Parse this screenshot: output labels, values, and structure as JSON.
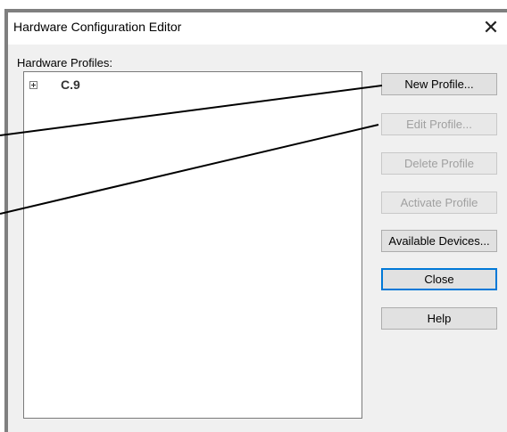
{
  "window": {
    "title": "Hardware Configuration Editor",
    "close_glyph": "✕",
    "close_icon": "close-icon"
  },
  "profiles": {
    "group_label": "Hardware Profiles:",
    "items": [
      {
        "label": "C.9",
        "expander_icon": "plus-expander-icon"
      }
    ]
  },
  "buttons": {
    "new_profile": "New Profile...",
    "edit_profile": "Edit Profile...",
    "delete_profile": "Delete Profile",
    "activate_profile": "Activate Profile",
    "available_devices": "Available Devices...",
    "close": "Close",
    "help": "Help"
  },
  "colors": {
    "dialog_bg": "#f0f0f0",
    "focus_border": "#0078d7",
    "disabled_text": "#a0a0a0",
    "callout_line": "#000000"
  }
}
